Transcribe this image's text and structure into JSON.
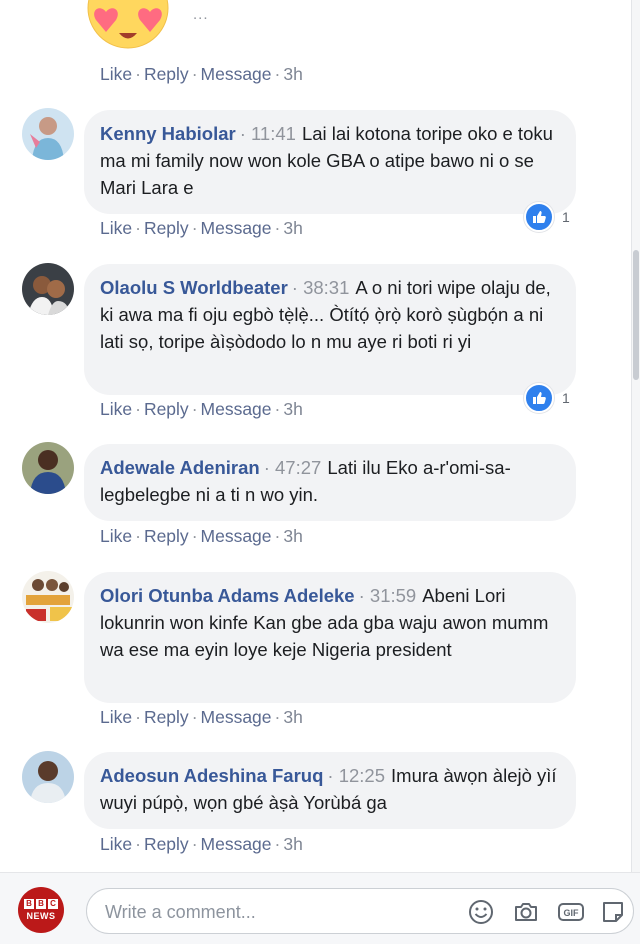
{
  "top_comment": {
    "actions": {
      "like": "Like",
      "reply": "Reply",
      "message": "Message",
      "time": "3h"
    },
    "more": "..."
  },
  "comments": [
    {
      "author": "Kenny Habiolar",
      "stamp": "11:41",
      "text": "Lai lai kotona toripe oko e toku ma mi family now won kole GBA o atipe bawo ni o se Mari Lara e",
      "reaction_count": "1",
      "actions": {
        "like": "Like",
        "reply": "Reply",
        "message": "Message",
        "time": "3h"
      }
    },
    {
      "author": "Olaolu S Worldbeater",
      "stamp": "38:31",
      "text": "A o ni tori wipe olaju de, ki awa ma fi oju egbò tẹ̀lẹ̀... Òtítọ́ ọ̀rọ̀ korò ṣùgbọ́n a ni lati sọ, toripe àìṣòdodo lo n mu aye ri boti ri yi",
      "reaction_count": "1",
      "actions": {
        "like": "Like",
        "reply": "Reply",
        "message": "Message",
        "time": "3h"
      }
    },
    {
      "author": "Adewale Adeniran",
      "stamp": "47:27",
      "text": "Lati ilu Eko a-r'omi-sa-legbelegbe ni a ti n wo yin.",
      "actions": {
        "like": "Like",
        "reply": "Reply",
        "message": "Message",
        "time": "3h"
      }
    },
    {
      "author": "Olori Otunba Adams Adeleke",
      "stamp": "31:59",
      "text": "Abeni Lori lokunrin won kinfe Kan gbe ada gba waju awon mumm wa ese ma eyin loye keje Nigeria president",
      "actions": {
        "like": "Like",
        "reply": "Reply",
        "message": "Message",
        "time": "3h"
      }
    },
    {
      "author": "Adeosun Adeshina Faruq",
      "stamp": "12:25",
      "text": "Imura àwọn àlejò yìí wuyi púpọ̀, wọn gbé àṣà Yorùbá ga",
      "actions": {
        "like": "Like",
        "reply": "Reply",
        "message": "Message",
        "time": "3h"
      }
    }
  ],
  "composer": {
    "placeholder": "Write a comment...",
    "page_avatar": {
      "blocks": [
        "B",
        "B",
        "C"
      ],
      "word": "NEWS"
    },
    "icons": [
      "emoji-icon",
      "camera-icon",
      "gif-icon",
      "sticker-icon"
    ],
    "gif_label": "GIF"
  },
  "colors": {
    "author": "#385898",
    "action": "#5b6a8f",
    "bubble": "#f2f3f5",
    "like_blue": "#2f80ed",
    "bbc_red": "#bb1919"
  }
}
